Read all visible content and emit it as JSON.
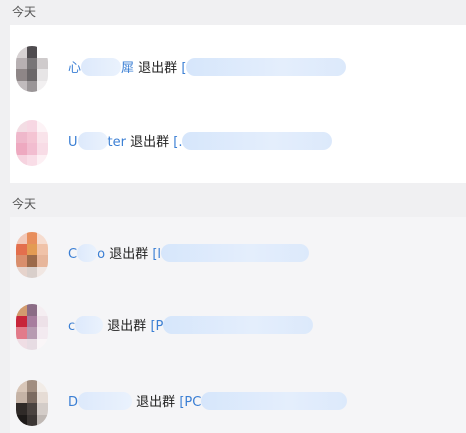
{
  "sections": [
    {
      "header": "今天",
      "rows": [
        {
          "name_start": "心",
          "name_end": "犀",
          "action": "退出群",
          "bracket": "["
        },
        {
          "name_start": "U",
          "name_end": "ter",
          "action": "退出群",
          "bracket": "[."
        }
      ]
    },
    {
      "header": "今天",
      "rows": [
        {
          "name_start": "C",
          "name_end": "o",
          "action": "退出群",
          "bracket": "[l"
        },
        {
          "name_start": "c",
          "name_end": "",
          "action": "退出群",
          "bracket": "[P"
        },
        {
          "name_start": "D",
          "name_end": "",
          "action": "退出群",
          "bracket": "[PC"
        }
      ]
    }
  ]
}
